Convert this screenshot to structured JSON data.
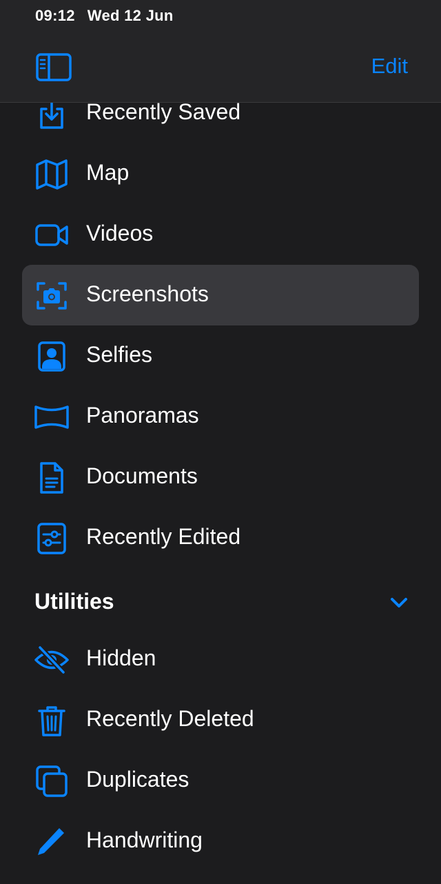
{
  "status_bar": {
    "time": "09:12",
    "date": "Wed 12 Jun"
  },
  "header": {
    "edit_label": "Edit"
  },
  "colors": {
    "accent": "#0a84ff",
    "background": "#1c1c1e",
    "topbar": "#252527",
    "selected_row": "#39393d",
    "text": "#ffffff"
  },
  "media_types": [
    {
      "label": "Recently Saved",
      "icon": "recently-saved-icon"
    },
    {
      "label": "Map",
      "icon": "map-icon"
    },
    {
      "label": "Videos",
      "icon": "video-camera-icon"
    },
    {
      "label": "Screenshots",
      "icon": "screenshot-camera-icon",
      "selected": true
    },
    {
      "label": "Selfies",
      "icon": "selfie-person-icon"
    },
    {
      "label": "Panoramas",
      "icon": "panorama-icon"
    },
    {
      "label": "Documents",
      "icon": "document-icon"
    },
    {
      "label": "Recently Edited",
      "icon": "sliders-icon"
    }
  ],
  "utilities": {
    "title": "Utilities",
    "items": [
      {
        "label": "Hidden",
        "icon": "eye-slash-icon"
      },
      {
        "label": "Recently Deleted",
        "icon": "trash-icon"
      },
      {
        "label": "Duplicates",
        "icon": "duplicate-squares-icon"
      },
      {
        "label": "Handwriting",
        "icon": "pencil-icon"
      }
    ]
  }
}
